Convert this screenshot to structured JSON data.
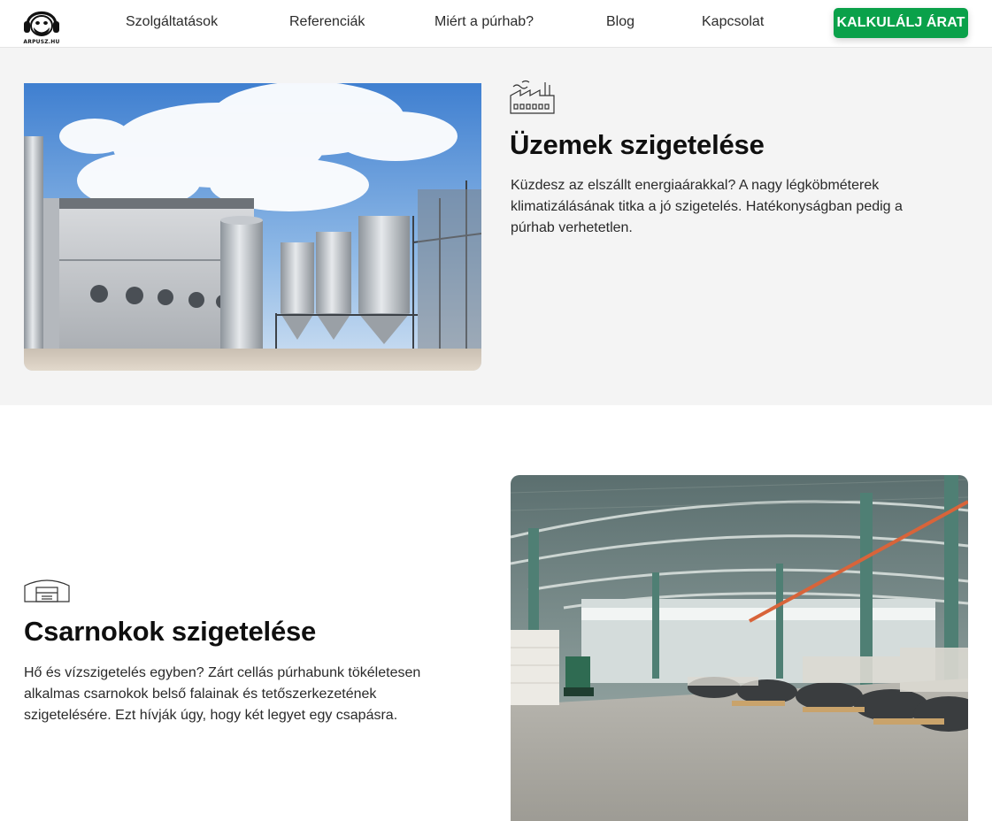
{
  "nav": {
    "logo_text": "ARPUSZ.HU",
    "links": [
      "Szolgáltatások",
      "Referenciák",
      "Miért a púrhab?",
      "Blog",
      "Kapcsolat"
    ],
    "cta_label": "KALKULÁLJ ÁRAT",
    "cta_color": "#0aa14a"
  },
  "section_factory": {
    "icon": "factory-icon",
    "title": "Üzemek szigetelése",
    "text": "Küzdesz az elszállt energiaárakkal? A nagy légköbméterek klimatizálásának titka a jó szigetelés. Hatékonyságban pedig a púrhab verhetetlen."
  },
  "section_hall": {
    "icon": "warehouse-icon",
    "title": "Csarnokok szigetelése",
    "text": "Hő és vízszigetelés egyben? Zárt cellás púrhabunk tökéletesen alkalmas csarnokok belső falainak és tetőszerkezetének szigetelésére. Ezt hívják úgy, hogy két legyet egy csapásra."
  }
}
